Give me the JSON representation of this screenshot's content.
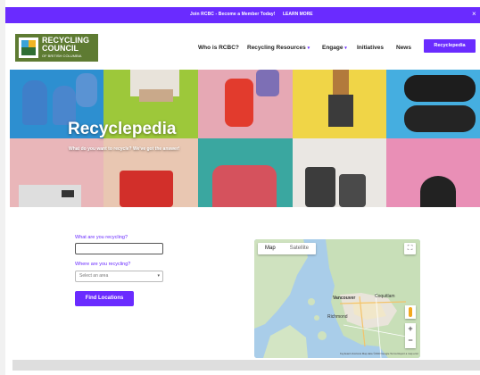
{
  "topbar": {
    "message": "Join RCBC - Become a Member Today!",
    "link": "LEARN MORE",
    "close": "×",
    "color": "#6a2bff"
  },
  "header": {
    "logo": {
      "line1": "RECYCLING",
      "line2": "COUNCIL",
      "line3": "OF BRITISH COLUMBIA"
    },
    "nav": [
      {
        "label": "Who is RCBC?",
        "caret": ""
      },
      {
        "label": "Recycling Resources",
        "caret": "▾"
      },
      {
        "label": "Engage",
        "caret": "▾"
      },
      {
        "label": "Initiatives",
        "caret": ""
      },
      {
        "label": "News",
        "caret": ""
      }
    ],
    "cta": "Recyclepedia"
  },
  "hero": {
    "title": "Recyclepedia",
    "subtitle": "What do you want to recycle? We've got the answer!"
  },
  "form": {
    "q1": "What are you recycling?",
    "q1_value": "",
    "q2": "Where are you recycling?",
    "select_value": "Select an area",
    "find": "Find Locations"
  },
  "map": {
    "type_map": "Map",
    "type_satellite": "Satellite",
    "labels": {
      "vancouver": "Vancouver",
      "richmond": "Richmond",
      "coquitlam": "Coquitlam"
    },
    "zoom_in": "+",
    "zoom_out": "−",
    "footer": "Keyboard shortcuts   Map data ©2023 Google   Terms   Report a map error"
  }
}
